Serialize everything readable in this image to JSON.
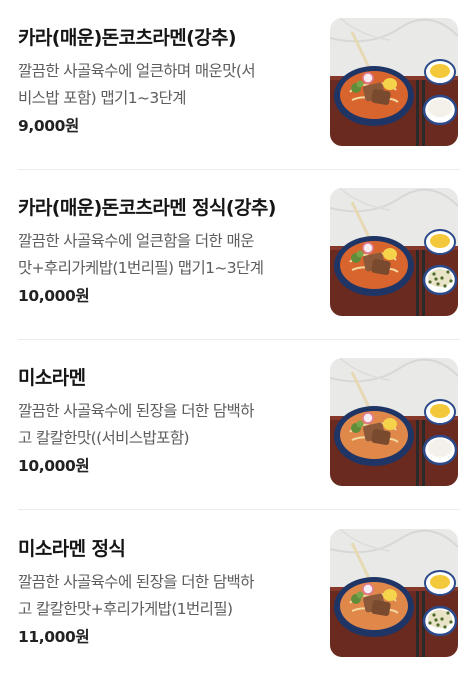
{
  "menu": {
    "items": [
      {
        "name": "카라(매운)돈코츠라멘(강추)",
        "desc_lines": [
          "깔끔한 사골육수에 얼큰하며 매운맛(서",
          "비스밥 포함) 맵기1~3단계"
        ],
        "price": "9,000원",
        "soup": "#d9652e",
        "rice": "plain"
      },
      {
        "name": "카라(매운)돈코츠라멘 정식(강추)",
        "desc_lines": [
          "깔끔한 사골육수에 얼큰함을 더한 매운",
          "맛+후리가케밥(1번리필) 맵기1~3단계"
        ],
        "price": "10,000원",
        "soup": "#d9652e",
        "rice": "furikake"
      },
      {
        "name": "미소라멘",
        "desc_lines": [
          "깔끔한 사골육수에 된장을 더한 담백하",
          "고 칼칼한맛((서비스밥포함)"
        ],
        "price": "10,000원",
        "soup": "#e0874a",
        "rice": "plain"
      },
      {
        "name": "미소라멘 정식",
        "desc_lines": [
          "깔끔한 사골육수에 된장을 더한 담백하",
          "고 칼칼한맛+후리가게밥(1번리필)"
        ],
        "price": "11,000원",
        "soup": "#e0874a",
        "rice": "furikake"
      }
    ]
  }
}
